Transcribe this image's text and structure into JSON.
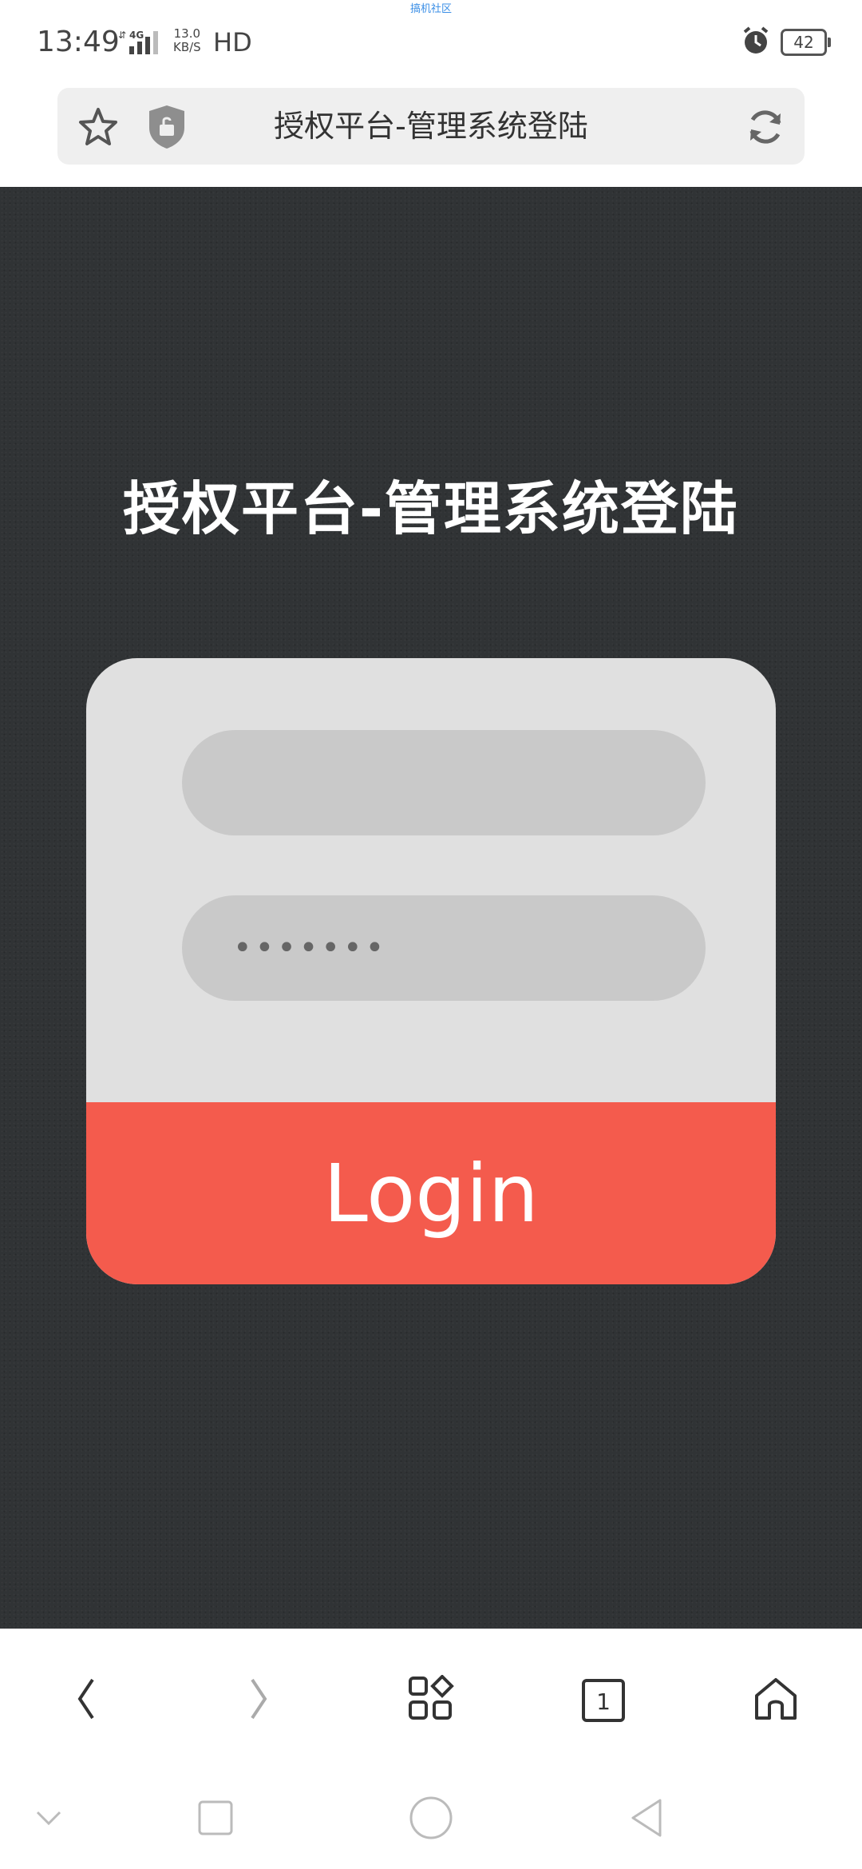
{
  "status_bar": {
    "watermark": "搞机社区",
    "time": "13:49",
    "network_type": "4G",
    "net_speed_value": "13.0",
    "net_speed_unit": "KB/S",
    "hd": "HD",
    "battery": "42"
  },
  "url_bar": {
    "title": "授权平台-管理系统登陆"
  },
  "page": {
    "title": "授权平台-管理系统登陆",
    "username_value": "",
    "password_value": "•••••••",
    "login_label": "Login"
  },
  "browser_nav": {
    "tab_count": "1"
  },
  "colors": {
    "page_bg": "#303335",
    "card_bg": "#e0e0e0",
    "input_bg": "#c9c9c9",
    "login_button": "#f45b4d"
  }
}
